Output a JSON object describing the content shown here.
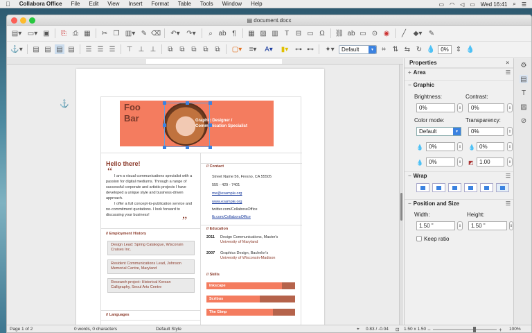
{
  "menubar": {
    "app": "Collabora Office",
    "items": [
      "File",
      "Edit",
      "View",
      "Insert",
      "Format",
      "Table",
      "Tools",
      "Window",
      "Help"
    ],
    "clock": "Wed 16:41"
  },
  "window": {
    "title": "document.docx"
  },
  "toolbar": {
    "paragraph_style": "Default",
    "transparency_value": "0%"
  },
  "doc": {
    "banner_name": "Foo\nBar",
    "banner_role_1": "Graphic Designer /",
    "banner_role_2": "Communication Specialist",
    "hello": "Hello there!",
    "open_quote": "“",
    "close_quote": "”",
    "about_1": "I am a visual communications specialist with a passion for digital mediums. Through a range of successful corporate and artistic projects I have developed a unique style and business-driven approach.",
    "about_2": "I offer a full concept-to-publication service and no-commitment quotations. I look forward to discussing your business!",
    "employment_heading": "// Employment History",
    "jobs": [
      "Design Lead: Spring Catalogue, Wisconsin Cruises Inc.",
      "Resident Communications Lead, Johnson Memorial Centre, Maryland",
      "Research project: Historical Korean Calligraphy, Seoul Arts Centre"
    ],
    "languages_heading": "// Languages",
    "contact_heading": "// Contact",
    "contact": {
      "address": "Street Name 56, Fresno, CA 55505",
      "phone": "555 - 429 - 7401",
      "email": "me@example.org",
      "web": "www.example.org",
      "twitter": "twitter.com/CollaboraOffice",
      "facebook": "fb.com/CollaboraOffice"
    },
    "education_heading": "// Education",
    "education": [
      {
        "year": "2011",
        "degree": "Design Communications, Master's",
        "school": "University of Maryland"
      },
      {
        "year": "2007",
        "degree": "Graphics Design, Bachelor's",
        "school": "University of Wisconsin-Madison"
      }
    ],
    "skills_heading": "// Skills",
    "skills": [
      {
        "name": "Inkscape",
        "level": 0.85
      },
      {
        "name": "Scribus",
        "level": 0.6
      },
      {
        "name": "The Gimp",
        "level": 0.75
      }
    ]
  },
  "sidebar": {
    "title": "Properties",
    "area": "Area",
    "graphic": "Graphic",
    "brightness_label": "Brightness:",
    "brightness": "0%",
    "contrast_label": "Contrast:",
    "contrast": "0%",
    "color_mode_label": "Color mode:",
    "color_mode": "Default",
    "transparency_label": "Transparency:",
    "transparency": "0%",
    "red": "0%",
    "green": "0%",
    "blue": "0%",
    "gamma": "1.00",
    "wrap": "Wrap",
    "pos_size": "Position and Size",
    "width_label": "Width:",
    "width": "1.50 \"",
    "height_label": "Height:",
    "height": "1.50 \"",
    "keep_ratio": "Keep ratio"
  },
  "status": {
    "page": "Page 1 of 2",
    "words": "0 words, 0 characters",
    "style": "Default Style",
    "pos": "0.83 / -0.04",
    "size": "1.50 x 1.50",
    "zoom": "100%"
  }
}
